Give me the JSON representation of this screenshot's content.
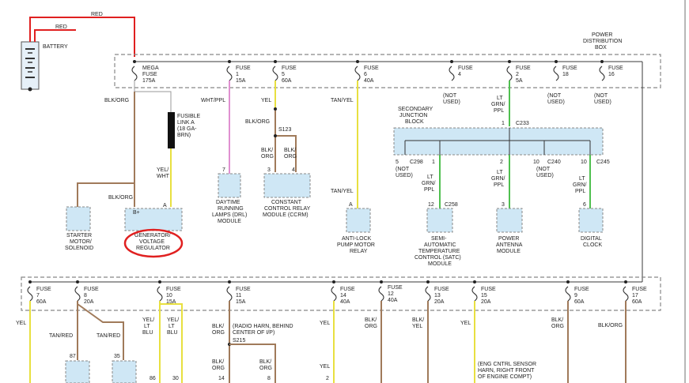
{
  "labels": {
    "red_top": "RED",
    "red_2": "RED",
    "battery": "BATTERY",
    "pdb": [
      "POWER",
      "DISTRIBUTION",
      "BOX"
    ],
    "mega_fuse": [
      "MEGA",
      "FUSE",
      "175A"
    ],
    "fuse_1": [
      "FUSE",
      "1",
      "15A"
    ],
    "fuse_5": [
      "FUSE",
      "5",
      "60A"
    ],
    "fuse_6": [
      "FUSE",
      "6",
      "40A"
    ],
    "fuse_4": [
      "FUSE",
      "4"
    ],
    "fuse_2": [
      "FUSE",
      "2",
      "5A"
    ],
    "fuse_18": [
      "FUSE",
      "18"
    ],
    "fuse_16": [
      "FUSE",
      "16"
    ],
    "not_used": [
      "(NOT",
      "USED)"
    ],
    "blk_org": "BLK/ORG",
    "blk": "BLK/",
    "org": "ORG",
    "fusible_link": [
      "FUSIBLE",
      "LINK A",
      "(18 GA-",
      "BRN)"
    ],
    "wht_ppl": "WHT/PPL",
    "yel": "YEL",
    "tan_yel": "TAN/YEL",
    "s123": "S123",
    "lt": "LT",
    "grn": "GRN/",
    "ppl": "PPL",
    "secondary_jb": [
      "SECONDARY",
      "JUNCTION",
      "BLOCK"
    ],
    "c233": "C233",
    "c298": "C298",
    "c240": "C240",
    "c245": "C245",
    "c258": "C258",
    "yel_wht": [
      "YEL/",
      "WHT"
    ],
    "drl": [
      "DAYTIME",
      "RUNNING",
      "LAMPS (DRL)",
      "MODULE"
    ],
    "ccrm": [
      "CONSTANT",
      "CONTROL RELAY",
      "MODULE (CCRM)"
    ],
    "starter": [
      "STARTER",
      "MOTOR/",
      "SOLENOID"
    ],
    "gen": [
      "GENERATOR/",
      "VOLTAGE",
      "REGULATOR"
    ],
    "abs": [
      "ANTI-LOCK",
      "PUMP MOTOR",
      "RELAY"
    ],
    "satc": [
      "SEMI-",
      "AUTOMATIC",
      "TEMPERATURE",
      "CONTROL (SATC)",
      "MODULE"
    ],
    "antenna": [
      "POWER",
      "ANTENNA",
      "MODULE"
    ],
    "clock": [
      "DIGITAL",
      "CLOCK"
    ],
    "b_plus": "B+",
    "a": "A",
    "pins": {
      "p7": "7",
      "p3": "3",
      "p4": "4",
      "p1": "1",
      "p2": "2",
      "p5": "5",
      "p10": "10",
      "p12": "12",
      "p6": "6"
    },
    "f7": [
      "FUSE",
      "7",
      "60A"
    ],
    "f8": [
      "FUSE",
      "8",
      "20A"
    ],
    "f10": [
      "FUSE",
      "10",
      "15A"
    ],
    "f11": [
      "FUSE",
      "11",
      "15A"
    ],
    "f14": [
      "FUSE",
      "14",
      "40A"
    ],
    "f12": [
      "FUSE",
      "12",
      "40A"
    ],
    "f13": [
      "FUSE",
      "13",
      "20A"
    ],
    "f15": [
      "FUSE",
      "15",
      "20A"
    ],
    "f9": [
      "FUSE",
      "9",
      "60A"
    ],
    "f17": [
      "FUSE",
      "17",
      "60A"
    ],
    "tan_red": "TAN/RED",
    "yel_lt_blu": [
      "YEL/",
      "LT",
      "BLU"
    ],
    "yel_slash": "YEL/",
    "radio_harn": [
      "(RADIO HARN, BEHIND",
      "CENTER OF I/P)"
    ],
    "s215": "S215",
    "eng_harn": [
      "(ENG CNTRL SENSOR",
      "HARN, RIGHT FRONT",
      "OF ENGINE COMPT)"
    ],
    "bottom_pins": {
      "p87": "87",
      "p35": "35",
      "p86": "86",
      "p30": "30",
      "p14": "14",
      "p8": "8",
      "p2": "2"
    }
  },
  "colors": {
    "red_wire": "#e02020",
    "brown_wire": "#a07a5a",
    "yellow_wire": "#e8e040",
    "pink_wire": "#e090d0",
    "green_wire": "#50c050",
    "component_fill": "#cfe7f5",
    "annotation_circle": "#e02020"
  }
}
